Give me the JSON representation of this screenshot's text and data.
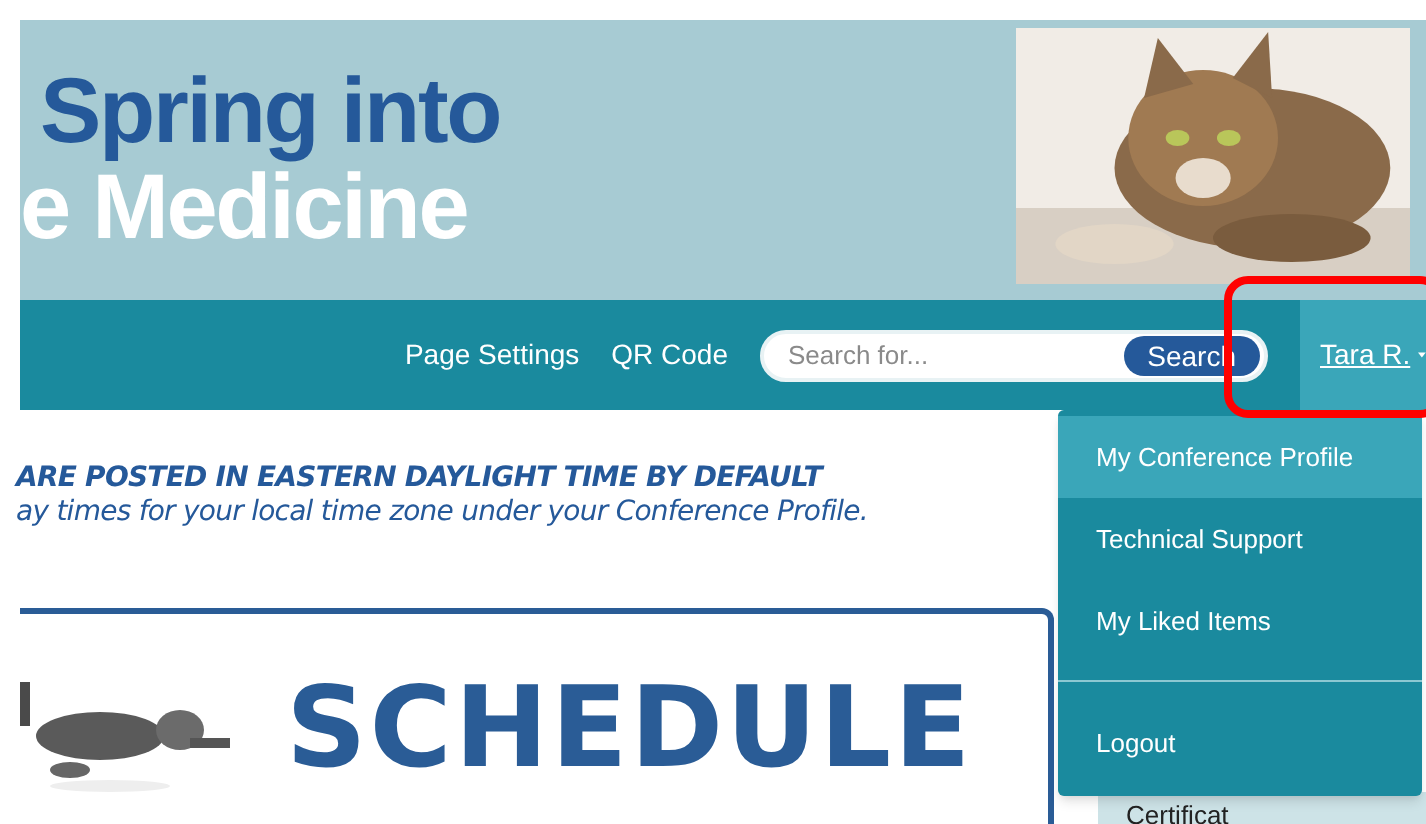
{
  "banner": {
    "title_line_1": "Spring into",
    "title_line_2": "e Medicine",
    "kind": "picture"
  },
  "nav": {
    "links": [
      "Page Settings",
      "QR Code"
    ],
    "search": {
      "placeholder": "Search for...",
      "button": "Search"
    },
    "user": {
      "name": "Tara R.",
      "expanded": true
    }
  },
  "user_menu": [
    {
      "label": "My Conference Profile",
      "selected": true
    },
    {
      "label": "Technical Support",
      "selected": false
    },
    {
      "label": "My Liked Items",
      "selected": false
    },
    {
      "label": "Logout",
      "selected": false
    }
  ],
  "notice": [
    "ARE POSTED IN EASTERN DAYLIGHT TIME BY DEFAULT",
    "ay times for your local time zone under your Conference Profile."
  ],
  "schedule_banner": {
    "title": "SCHEDULE"
  },
  "side_card": {
    "title": "Certificat"
  }
}
